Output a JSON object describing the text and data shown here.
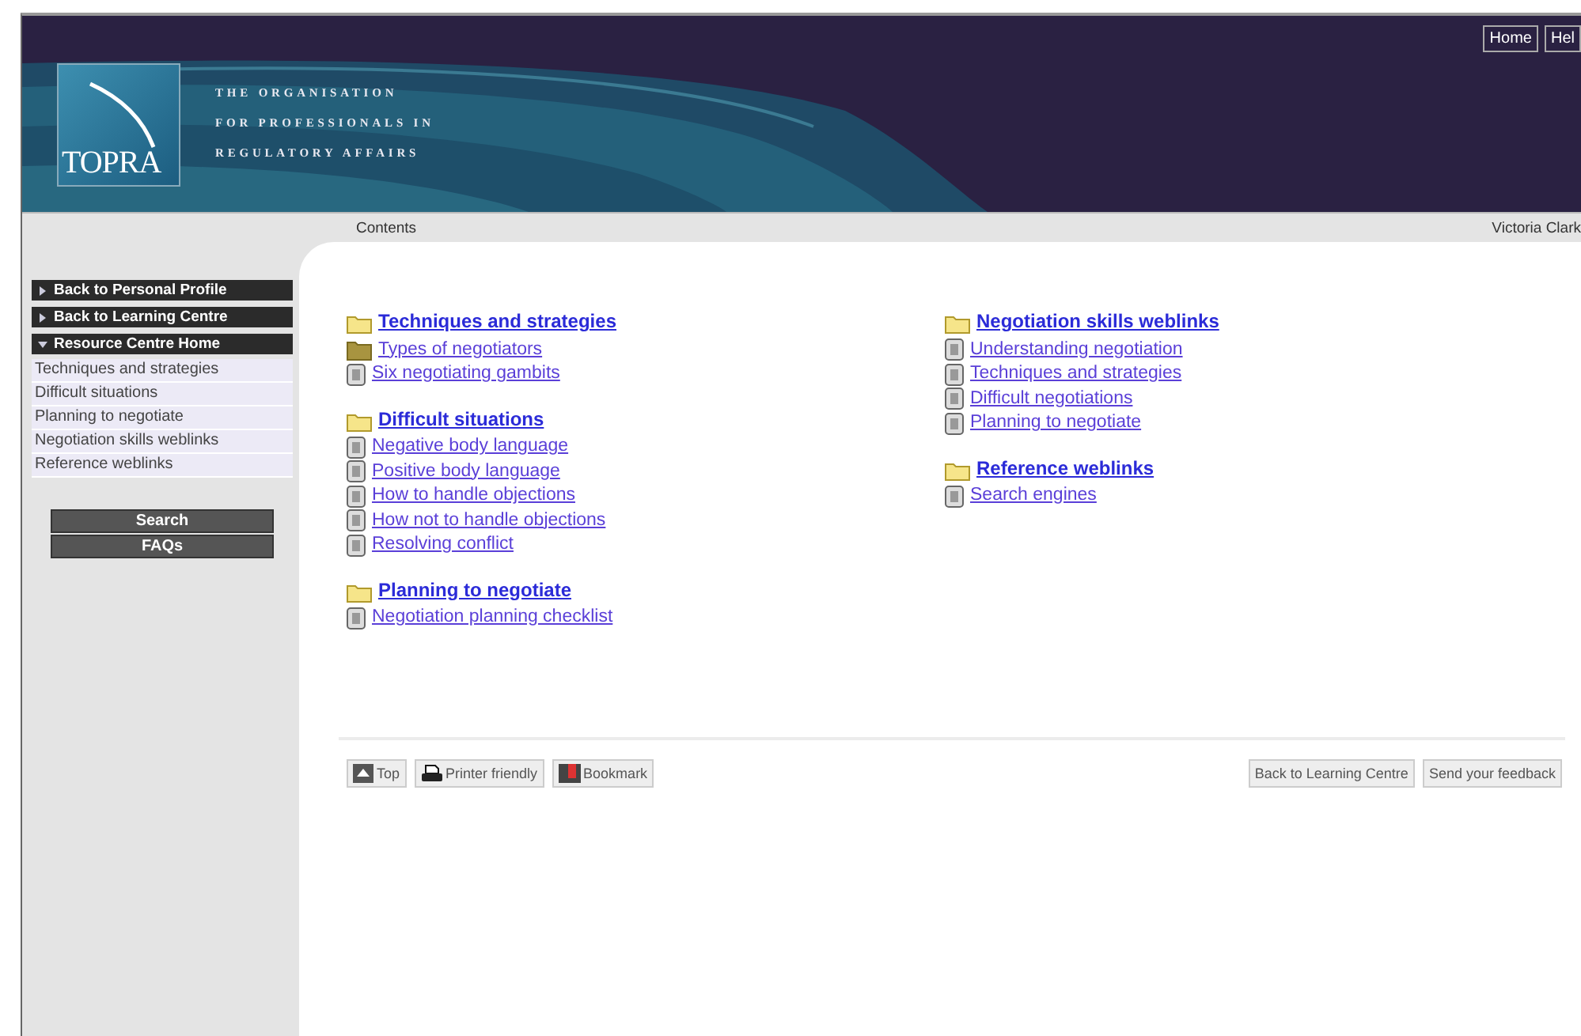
{
  "header": {
    "logo": "TOPRA",
    "tagline": [
      "THE ORGANISATION",
      "FOR PROFESSIONALS IN",
      "REGULATORY AFFAIRS"
    ],
    "buttons": [
      "Home",
      "Hel"
    ]
  },
  "contents_bar": {
    "title": "Contents",
    "user": "Victoria Clark"
  },
  "sidebar": {
    "nav": [
      {
        "label": "Back to Personal Profile",
        "expanded": false
      },
      {
        "label": "Back to Learning Centre",
        "expanded": false
      },
      {
        "label": "Resource Centre Home",
        "expanded": true
      }
    ],
    "items": [
      "Techniques and strategies",
      "Difficult situations",
      "Planning to negotiate",
      "Negotiation skills weblinks",
      "Reference weblinks"
    ],
    "buttons": [
      "Search",
      "FAQs"
    ]
  },
  "columns": [
    [
      {
        "title": "Techniques and strategies",
        "links": [
          {
            "label": "Types of negotiators",
            "kind": "folder"
          },
          {
            "label": "Six negotiating gambits",
            "kind": "page"
          }
        ]
      },
      {
        "title": "Difficult situations",
        "links": [
          {
            "label": "Negative body language",
            "kind": "page"
          },
          {
            "label": "Positive body language",
            "kind": "page"
          },
          {
            "label": "How to handle objections",
            "kind": "page"
          },
          {
            "label": "How not to handle objections",
            "kind": "page"
          },
          {
            "label": "Resolving conflict",
            "kind": "page"
          }
        ]
      },
      {
        "title": "Planning to negotiate",
        "links": [
          {
            "label": "Negotiation planning checklist",
            "kind": "page"
          }
        ]
      }
    ],
    [
      {
        "title": "Negotiation skills weblinks",
        "links": [
          {
            "label": "Understanding negotiation",
            "kind": "page"
          },
          {
            "label": "Techniques and strategies",
            "kind": "page"
          },
          {
            "label": "Difficult negotiations",
            "kind": "page"
          },
          {
            "label": "Planning to negotiate",
            "kind": "page"
          }
        ]
      },
      {
        "title": "Reference weblinks",
        "links": [
          {
            "label": "Search engines",
            "kind": "page"
          }
        ]
      }
    ]
  ],
  "footer": {
    "tools": [
      {
        "label": "Top",
        "kind": "top"
      },
      {
        "label": "Printer friendly",
        "kind": "print"
      },
      {
        "label": "Bookmark",
        "kind": "bookmark"
      }
    ],
    "buttons": [
      "Back to Learning Centre",
      "Send your feedback"
    ]
  }
}
